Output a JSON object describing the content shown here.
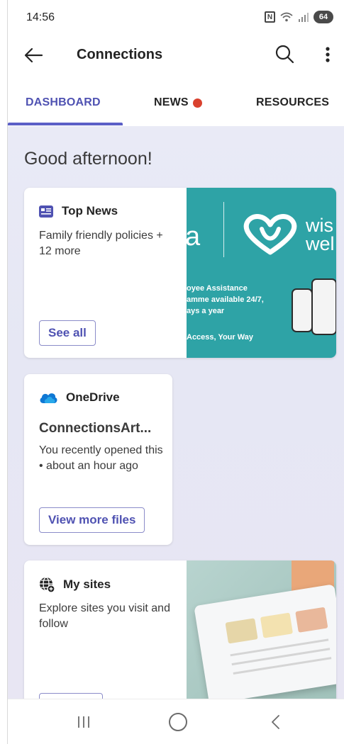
{
  "status_bar": {
    "time": "14:56",
    "nfc": "N",
    "battery": "64"
  },
  "app_bar": {
    "title": "Connections"
  },
  "tabs": [
    {
      "label": "DASHBOARD",
      "selected": true
    },
    {
      "label": "NEWS",
      "has_notification": true
    },
    {
      "label": "RESOURCES"
    }
  ],
  "greeting": "Good afternoon!",
  "top_news": {
    "title": "Top News",
    "description": "Family friendly policies + 12 more",
    "button": "See all",
    "promo": {
      "fragment_a": "a",
      "brand_line1": "wis",
      "brand_line2": "wel",
      "line1": "oyee Assistance",
      "line2": "amme available 24/7,",
      "line3": "ays a year",
      "line4": "Access, Your Way"
    }
  },
  "onedrive": {
    "title": "OneDrive",
    "file_name": "ConnectionsArt...",
    "description": "You recently opened this • about an hour ago",
    "button": "View more files"
  },
  "my_sites": {
    "title": "My sites",
    "description": "Explore sites you visit and follow"
  },
  "colors": {
    "accent": "#5b5fc7",
    "accent_text": "#4f52b2",
    "notification_dot": "#d9412e",
    "promo_teal": "#2ea3a6",
    "content_bg": "#e8e9f5"
  },
  "icons": {
    "back": "arrow-left-icon",
    "search": "search-icon",
    "more": "more-vertical-icon",
    "top_news": "news-icon",
    "onedrive": "cloud-icon",
    "my_sites": "globe-icon"
  }
}
